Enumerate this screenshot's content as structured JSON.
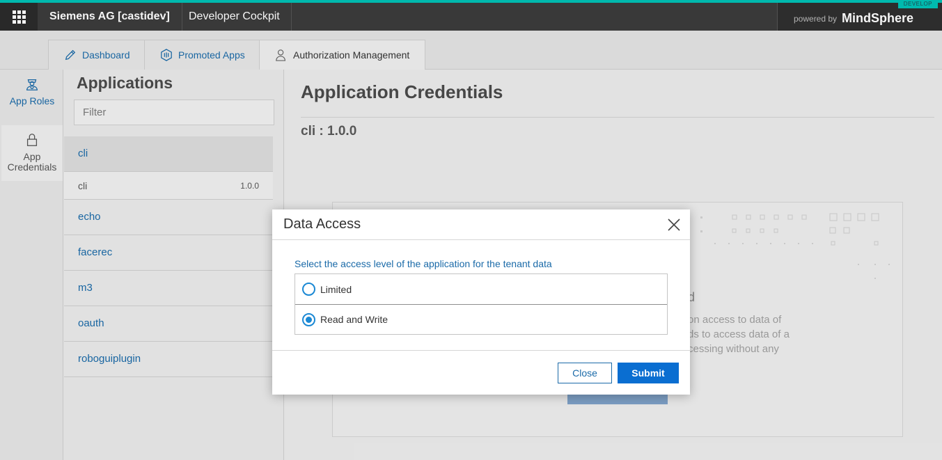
{
  "header": {
    "tenant": "Siemens AG [castidev]",
    "app_title": "Developer Cockpit",
    "powered_by": "powered by",
    "brand": "MindSphere",
    "env_badge": "DEVELOP"
  },
  "tabs": [
    {
      "label": "Dashboard",
      "icon": "pencil-icon"
    },
    {
      "label": "Promoted Apps",
      "icon": "hexagon-icon"
    },
    {
      "label": "Authorization Management",
      "icon": "user-lock-icon"
    }
  ],
  "sidenav": {
    "items": [
      {
        "label": "App Roles",
        "icon": "role-user-icon"
      },
      {
        "label": "App Credentials",
        "icon": "lock-icon"
      }
    ]
  },
  "applications": {
    "title": "Applications",
    "filter_placeholder": "Filter",
    "items": [
      "cli",
      "echo",
      "facerec",
      "m3",
      "oauth",
      "roboguiplugin"
    ],
    "selected_version": {
      "name": "cli",
      "version": "1.0.0"
    }
  },
  "main": {
    "title": "Application Credentials",
    "subtitle": "cli : 1.0.0",
    "card_title_fragment": "d",
    "card_text_lines": [
      "on access to data of",
      "ds to access data of a",
      "cessing without any"
    ]
  },
  "modal": {
    "title": "Data Access",
    "prompt": "Select the access level of the application for the tenant data",
    "options": [
      {
        "label": "Limited",
        "selected": false
      },
      {
        "label": "Read and Write",
        "selected": true
      }
    ],
    "close_label": "Close",
    "submit_label": "Submit"
  },
  "colors": {
    "accent": "#0a6ed1",
    "link": "#1a6aa8",
    "topbar": "#3c3c3c",
    "brand_stripe": "#00c1b6"
  }
}
